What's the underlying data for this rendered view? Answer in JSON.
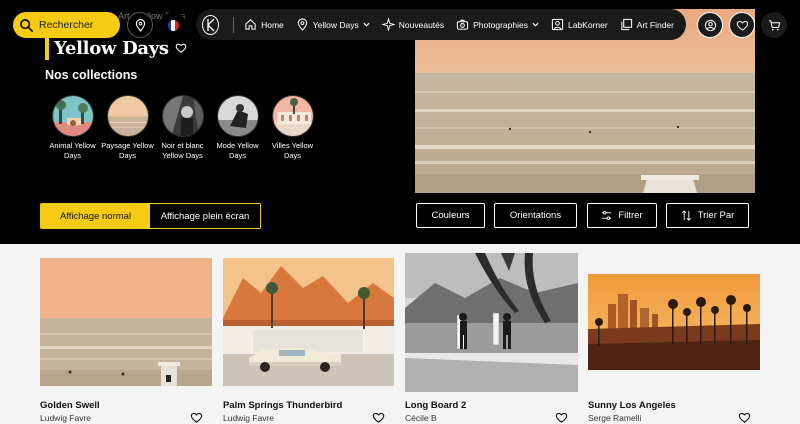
{
  "header": {
    "search_label": "Rechercher",
    "breadcrumb": "Art  /  Yellow Days",
    "nav": {
      "home": "Home",
      "yellow_days": "Yellow Days",
      "nouveautes": "Nouveautés",
      "photographies": "Photographies",
      "labkorner": "LabKorner",
      "art_finder": "Art Finder"
    }
  },
  "hero": {
    "title": "Yellow Days",
    "collections_heading": "Nos collections",
    "collections": [
      {
        "label": "Animal Yellow Days"
      },
      {
        "label": "Paysage Yellow Days"
      },
      {
        "label": "Noir et blanc Yellow Days"
      },
      {
        "label": "Mode Yellow Days"
      },
      {
        "label": "Villes Yellow Days"
      }
    ],
    "view_normal": "Affichage normal",
    "view_fullscreen": "Affichage plein écran",
    "filters": {
      "colors": "Couleurs",
      "orientations": "Orientations",
      "filter": "Filtrer",
      "sort": "Trier Par"
    }
  },
  "products": [
    {
      "title": "Golden Swell",
      "artist": "Ludwig Favre"
    },
    {
      "title": "Palm Springs Thunderbird",
      "artist": "Ludwig Favre"
    },
    {
      "title": "Long Board 2",
      "artist": "Cécile B"
    },
    {
      "title": "Sunny Los Angeles",
      "artist": "Serge Ramelli"
    }
  ],
  "colors": {
    "accent": "#f6cb14",
    "dark": "#000000",
    "page_bg": "#f4f4f5"
  },
  "icons": [
    "search-icon",
    "location-pin-icon",
    "french-flag-icon",
    "brand-logo-icon",
    "home-icon",
    "chevron-down-icon",
    "sparkle-icon",
    "camera-icon",
    "user-square-icon",
    "frames-icon",
    "user-icon",
    "heart-icon",
    "cart-icon",
    "sliders-icon",
    "sort-arrows-icon"
  ]
}
